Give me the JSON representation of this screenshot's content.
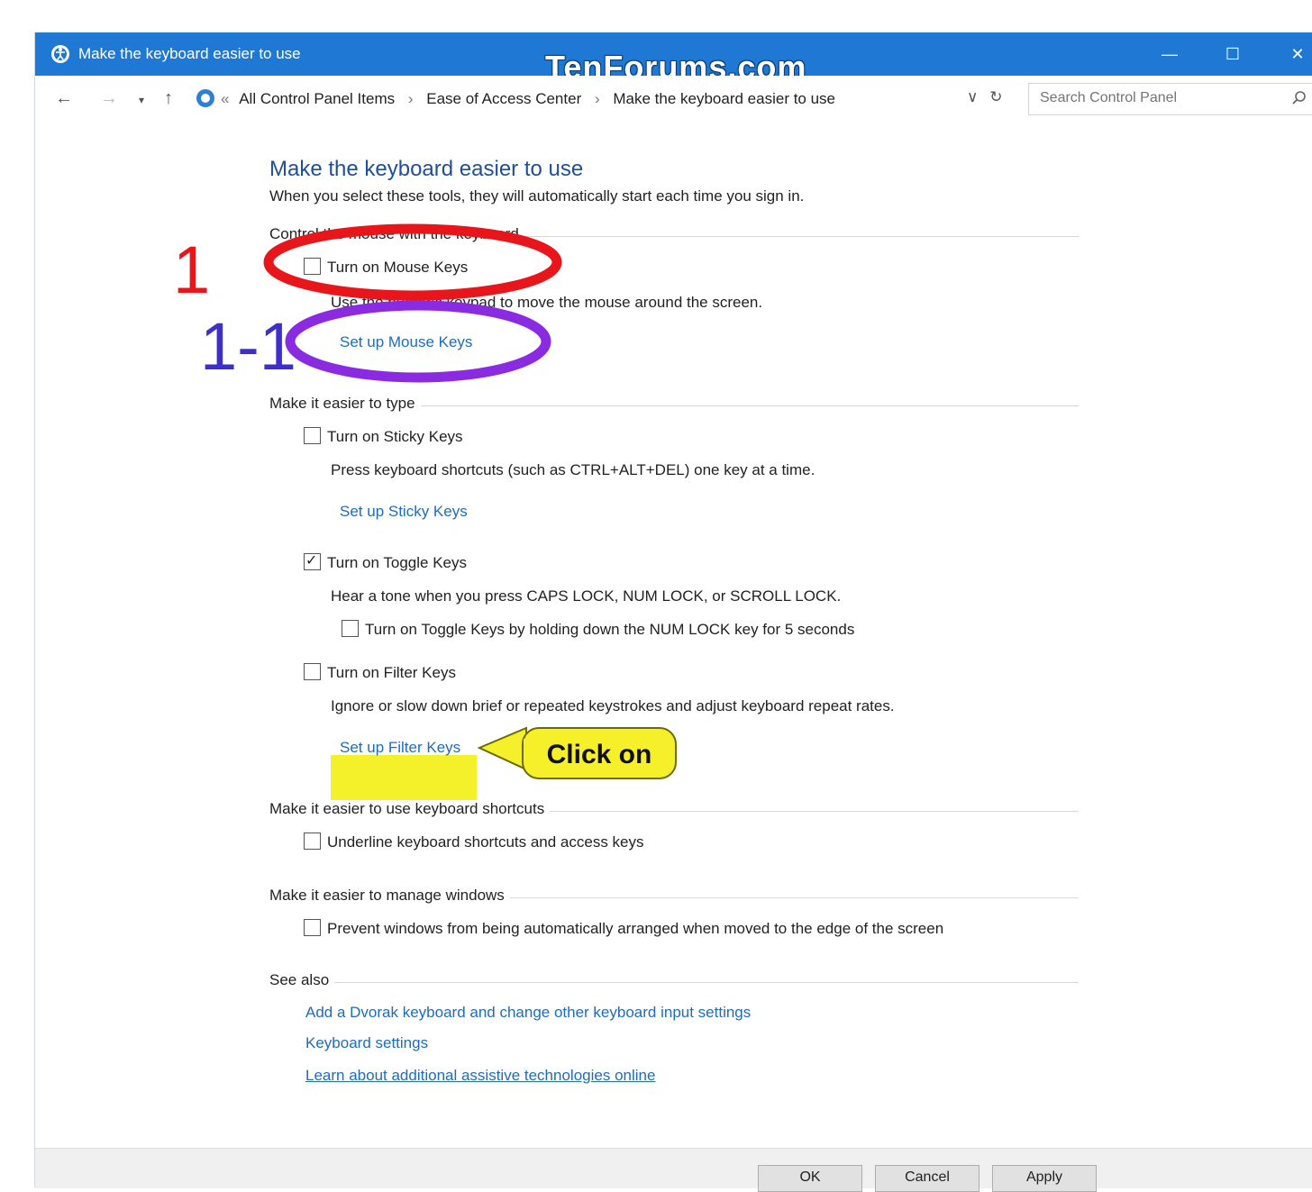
{
  "window": {
    "title": "Make the keyboard easier to use",
    "watermark": "TenForums.com",
    "controls": {
      "minimize": "—",
      "maximize": "☐",
      "close": "✕"
    }
  },
  "address_bar": {
    "crumbs": [
      "All Control Panel Items",
      "Ease of Access Center",
      "Make the keyboard easier to use"
    ],
    "search_placeholder": "Search Control Panel"
  },
  "page": {
    "heading": "Make the keyboard easier to use",
    "description": "When you select these tools, they will automatically start each time you sign in.",
    "sections": {
      "mouse": {
        "label": "Control the mouse with the keyboard",
        "checkbox": "Turn on Mouse Keys",
        "checked": false,
        "note": "Use the numeric keypad to move the mouse around the screen.",
        "link": "Set up Mouse Keys"
      },
      "type": {
        "label": "Make it easier to type",
        "sticky": {
          "checkbox": "Turn on Sticky Keys",
          "checked": false,
          "note": "Press keyboard shortcuts (such as CTRL+ALT+DEL) one key at a time.",
          "link": "Set up Sticky Keys"
        },
        "toggle": {
          "checkbox": "Turn on Toggle Keys",
          "checked": true,
          "note": "Hear a tone when you press CAPS LOCK, NUM LOCK, or SCROLL LOCK.",
          "sub_checkbox": "Turn on Toggle Keys by holding down the NUM LOCK key for 5 seconds",
          "sub_checked": false
        },
        "filter": {
          "checkbox": "Turn on Filter Keys",
          "checked": false,
          "note": "Ignore or slow down brief or repeated keystrokes and adjust keyboard repeat rates.",
          "link": "Set up Filter Keys"
        }
      },
      "shortcuts": {
        "label": "Make it easier to use keyboard shortcuts",
        "checkbox": "Underline keyboard shortcuts and access keys",
        "checked": false
      },
      "windows": {
        "label": "Make it easier to manage windows",
        "checkbox": "Prevent windows from being automatically arranged when moved to the edge of the screen",
        "checked": false
      },
      "see_also": {
        "label": "See also",
        "links": [
          "Add a Dvorak keyboard and change other keyboard input settings",
          "Keyboard settings",
          "Learn about additional assistive technologies online"
        ]
      }
    }
  },
  "footer": {
    "ok": "OK",
    "cancel": "Cancel",
    "apply": "Apply"
  },
  "annotations": {
    "step1": "1",
    "step1_1": "1-1",
    "callout": "Click on",
    "colors": {
      "red": "#e8151b",
      "purple": "#8a2be2",
      "callout": "#f6f02a",
      "label1_1": "#3d2fc9"
    }
  }
}
